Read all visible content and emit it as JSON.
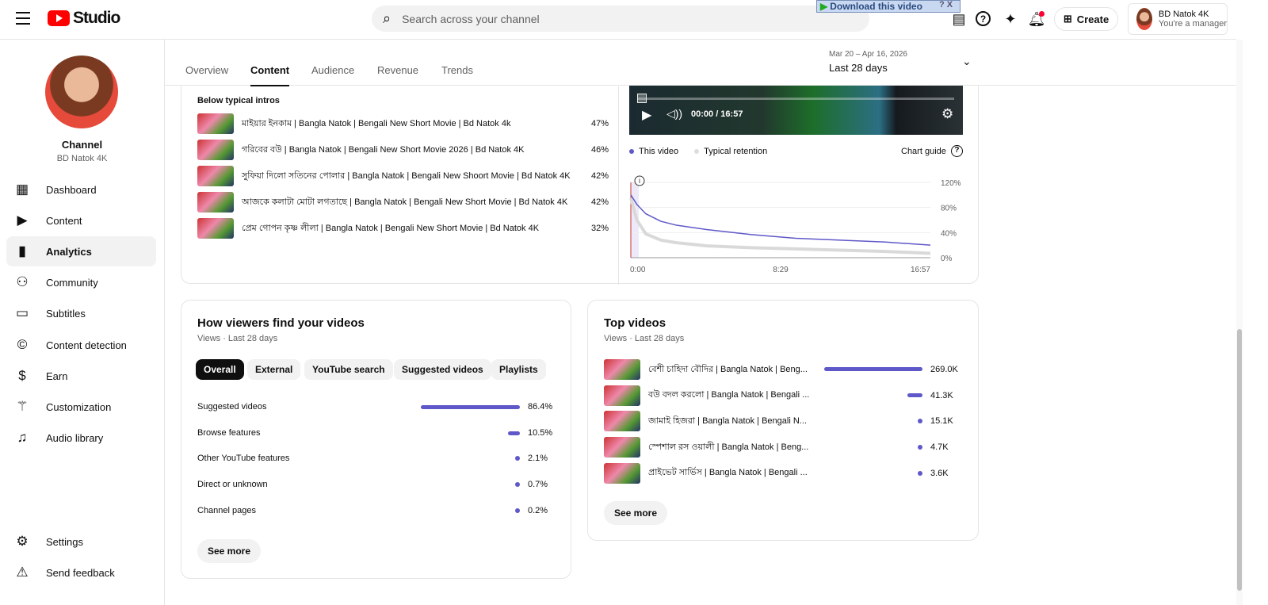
{
  "header": {
    "logo": "Studio",
    "search_placeholder": "Search across your channel",
    "download_banner": "Download this video",
    "download_help": "?",
    "download_close": "X",
    "create_label": "Create",
    "account_name": "BD Natok 4K",
    "account_role": "You're a manager"
  },
  "sidebar": {
    "channel_label": "Channel",
    "channel_name": "BD Natok 4K",
    "items": [
      {
        "label": "Dashboard"
      },
      {
        "label": "Content"
      },
      {
        "label": "Analytics"
      },
      {
        "label": "Community"
      },
      {
        "label": "Subtitles"
      },
      {
        "label": "Content detection"
      },
      {
        "label": "Earn"
      },
      {
        "label": "Customization"
      },
      {
        "label": "Audio library"
      }
    ],
    "settings": "Settings",
    "feedback": "Send feedback"
  },
  "tabs": {
    "items": [
      "Overview",
      "Content",
      "Audience",
      "Revenue",
      "Trends"
    ],
    "active": "Content",
    "date_range": "Mar 20 – Apr 16, 2026",
    "period": "Last 28 days"
  },
  "intros": {
    "heading": "Below typical intros",
    "rows": [
      {
        "title": "মাইয়ার ইনকাম | Bangla Natok | Bengali New Short Movie | Bd Natok 4k",
        "pct": "47%"
      },
      {
        "title": "গরিবের বউ | Bangla Natok | Bengali New Short Movie 2026 | Bd Natok 4K",
        "pct": "46%"
      },
      {
        "title": "সুফিয়া দিলো সতিনের পোলার | Bangla Natok | Bengali New Shoort Movie | Bd Natok 4K",
        "pct": "42%"
      },
      {
        "title": "আজকে কলাটা মোটা লগতাছে | Bangla Natok | Bengali New Short Movie | Bd Natok 4K",
        "pct": "42%"
      },
      {
        "title": "প্রেম গোপন কৃষ্ণ লীলা | Bangla Natok | Bengali New Short Movie | Bd Natok 4K",
        "pct": "32%"
      }
    ]
  },
  "player": {
    "time": "00:00 / 16:57"
  },
  "chart_data": {
    "type": "line",
    "legend": [
      "This video",
      "Typical retention"
    ],
    "chart_guide": "Chart guide",
    "ylim": [
      0,
      120
    ],
    "yticks": [
      "120%",
      "80%",
      "40%",
      "0%"
    ],
    "xticks": [
      "0:00",
      "8:29",
      "16:57"
    ],
    "x_fraction": [
      0,
      0.02,
      0.05,
      0.1,
      0.15,
      0.25,
      0.4,
      0.55,
      0.7,
      0.85,
      1
    ],
    "series": [
      {
        "name": "This video",
        "color": "#5f58c8",
        "values": [
          100,
          85,
          70,
          58,
          52,
          45,
          37,
          31,
          28,
          25,
          20
        ]
      },
      {
        "name": "Typical retention",
        "color": "#d9d9d9",
        "values": [
          95,
          60,
          38,
          28,
          24,
          19,
          16,
          14,
          12,
          10,
          7
        ]
      }
    ]
  },
  "traffic": {
    "title": "How viewers find your videos",
    "subtitle": "Views · Last 28 days",
    "chips": [
      "Overall",
      "External",
      "YouTube search",
      "Suggested videos",
      "Playlists"
    ],
    "rows": [
      {
        "label": "Suggested videos",
        "value": "86.4%",
        "pct": 86.4
      },
      {
        "label": "Browse features",
        "value": "10.5%",
        "pct": 10.5
      },
      {
        "label": "Other YouTube features",
        "value": "2.1%",
        "pct": 2.1
      },
      {
        "label": "Direct or unknown",
        "value": "0.7%",
        "pct": 0.7
      },
      {
        "label": "Channel pages",
        "value": "0.2%",
        "pct": 0.2
      }
    ],
    "see_more": "See more"
  },
  "top_videos": {
    "title": "Top videos",
    "subtitle": "Views · Last 28 days",
    "rows": [
      {
        "title": "বেশী চাহিদা বৌদির | Bangla Natok | Beng...",
        "value": "269.0K",
        "views": 269000
      },
      {
        "title": "বউ বদল করলো | Bangla Natok | Bengali ...",
        "value": "41.3K",
        "views": 41300
      },
      {
        "title": "জামাই হিজরা | Bangla Natok | Bengali N...",
        "value": "15.1K",
        "views": 15100
      },
      {
        "title": "স্পেশাল রস ওয়ালী | Bangla Natok | Beng...",
        "value": "4.7K",
        "views": 4700
      },
      {
        "title": "প্রাইভেট সার্ভিস | Bangla Natok | Bengali ...",
        "value": "3.6K",
        "views": 3600
      }
    ],
    "see_more": "See more"
  }
}
